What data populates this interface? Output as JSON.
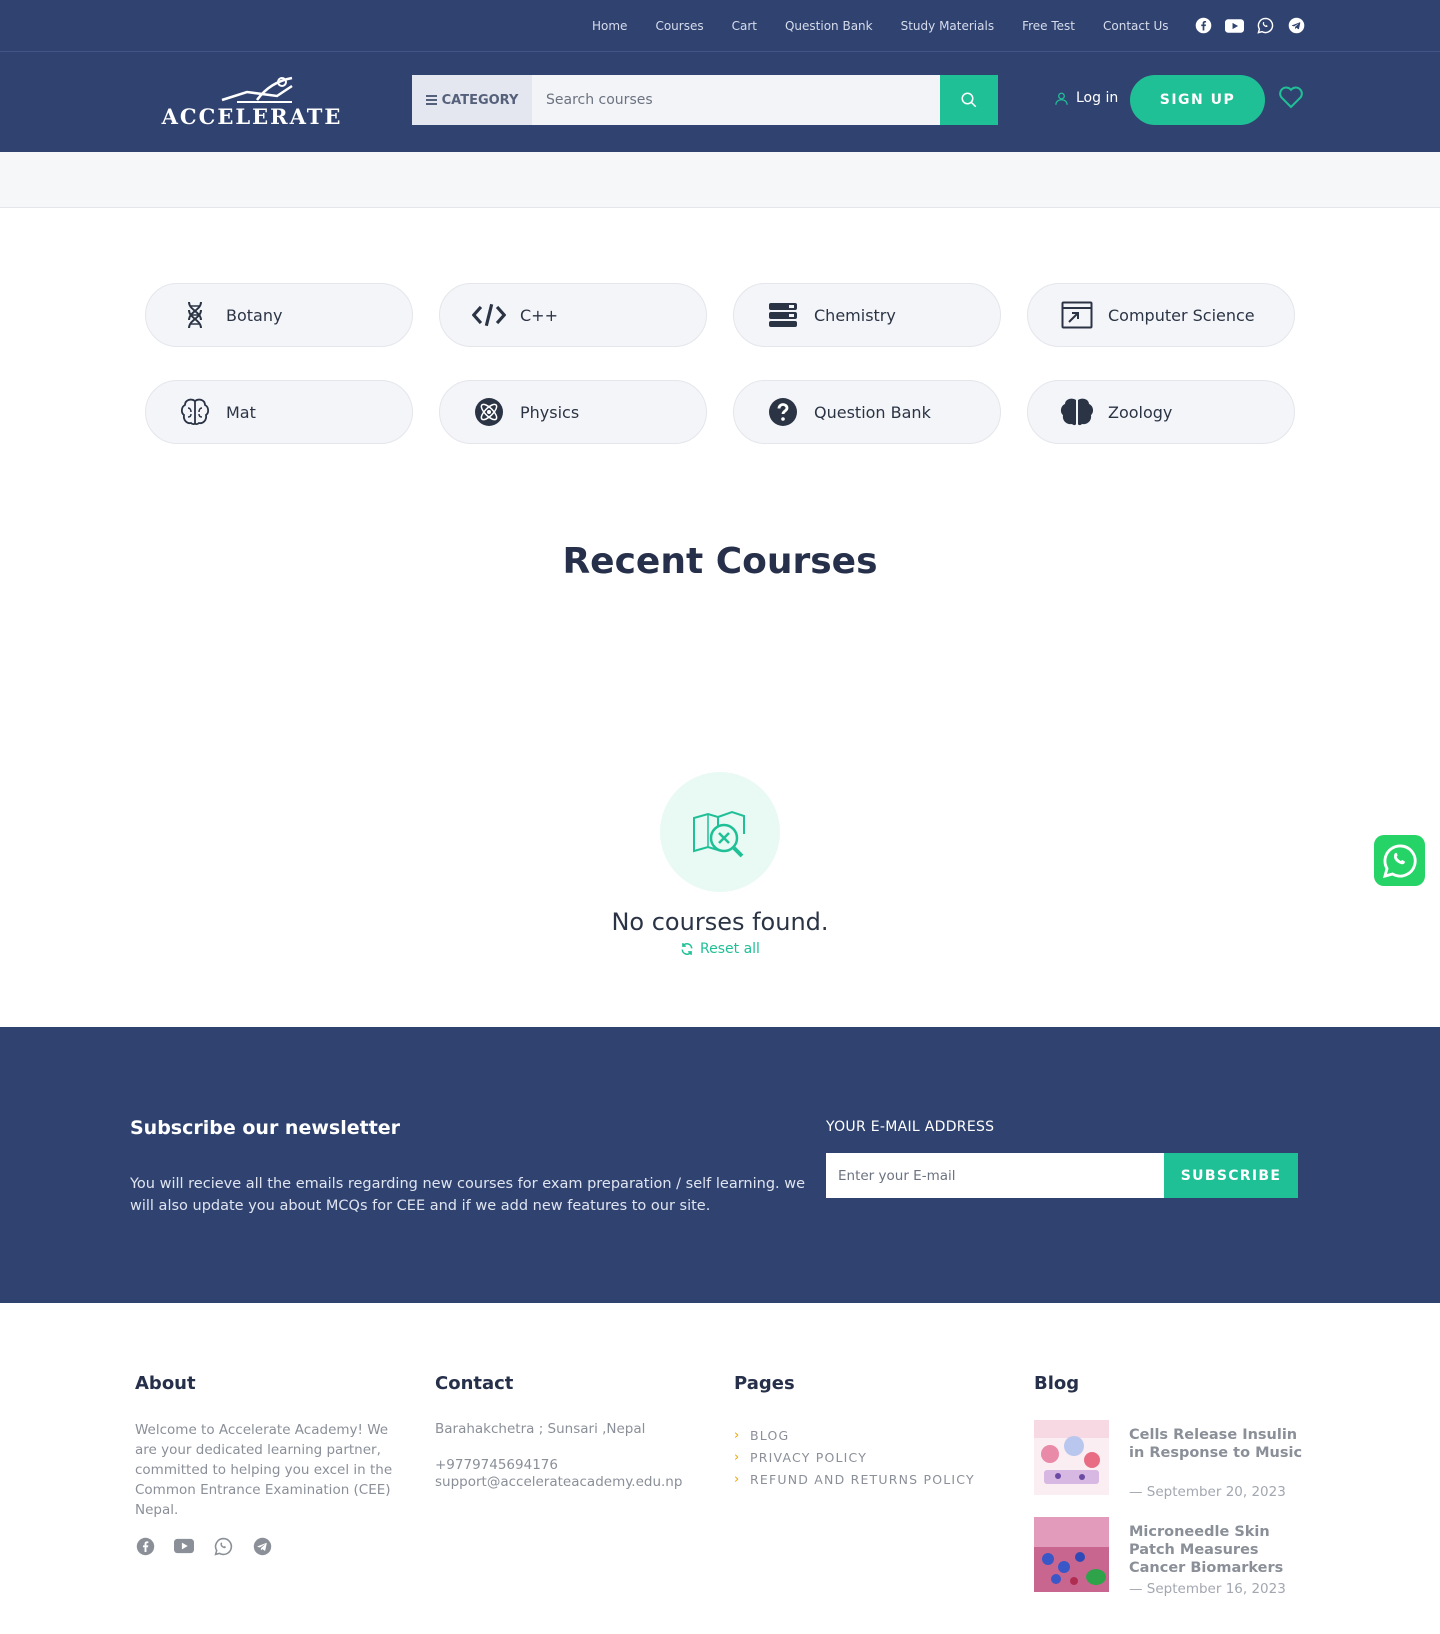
{
  "topnav": {
    "items": [
      {
        "label": "Home"
      },
      {
        "label": "Courses"
      },
      {
        "label": "Cart"
      },
      {
        "label": "Question Bank"
      },
      {
        "label": "Study Materials"
      },
      {
        "label": "Free Test"
      },
      {
        "label": "Contact Us"
      }
    ],
    "social_icons": [
      "facebook-icon",
      "youtube-icon",
      "whatsapp-icon",
      "telegram-icon"
    ]
  },
  "header": {
    "logo_text": "ACCELERATE",
    "category_label": "CATEGORY",
    "search_placeholder": "Search courses",
    "login_label": "Log in",
    "signup_label": "SIGN UP"
  },
  "categories": [
    {
      "label": "Botany",
      "icon": "dna-icon"
    },
    {
      "label": "C++",
      "icon": "code-icon"
    },
    {
      "label": "Chemistry",
      "icon": "layers-icon"
    },
    {
      "label": "Computer Science",
      "icon": "window-icon"
    },
    {
      "label": "Mat",
      "icon": "brain-outline-icon"
    },
    {
      "label": "Physics",
      "icon": "atom-icon"
    },
    {
      "label": "Question Bank",
      "icon": "question-icon"
    },
    {
      "label": "Zoology",
      "icon": "brain-solid-icon"
    }
  ],
  "recent": {
    "title": "Recent Courses",
    "empty_text": "No courses found.",
    "reset_label": "Reset all"
  },
  "newsletter": {
    "title": "Subscribe our newsletter",
    "description": "You will recieve all the emails regarding new courses for exam preparation / self learning. we will also update you about MCQs for CEE and if we add new features to our site.",
    "email_label": "YOUR E-MAIL ADDRESS",
    "email_placeholder": "Enter your E-mail",
    "button_label": "SUBSCRIBE"
  },
  "footer": {
    "about": {
      "title": "About",
      "text": "Welcome to Accelerate Academy! We are your dedicated learning partner, committed to helping you excel in the Common Entrance Examination (CEE) Nepal."
    },
    "contact": {
      "title": "Contact",
      "address": "Barahakchetra ; Sunsari ,Nepal",
      "phone": "+9779745694176",
      "email": "support@accelerateacademy.edu.np"
    },
    "pages": {
      "title": "Pages",
      "items": [
        {
          "label": "BLOG"
        },
        {
          "label": "PRIVACY POLICY"
        },
        {
          "label": "REFUND AND RETURNS POLICY"
        }
      ]
    },
    "blog": {
      "title": "Blog",
      "posts": [
        {
          "title": "Cells Release Insulin in Response to Music",
          "date": "— September 20, 2023"
        },
        {
          "title": "Microneedle Skin Patch Measures Cancer Biomarkers",
          "date": "— September 16, 2023"
        }
      ]
    }
  },
  "colors": {
    "navy": "#304370",
    "accent": "#20c097",
    "text_dark": "#26304a",
    "text_muted": "#8a8f98"
  }
}
